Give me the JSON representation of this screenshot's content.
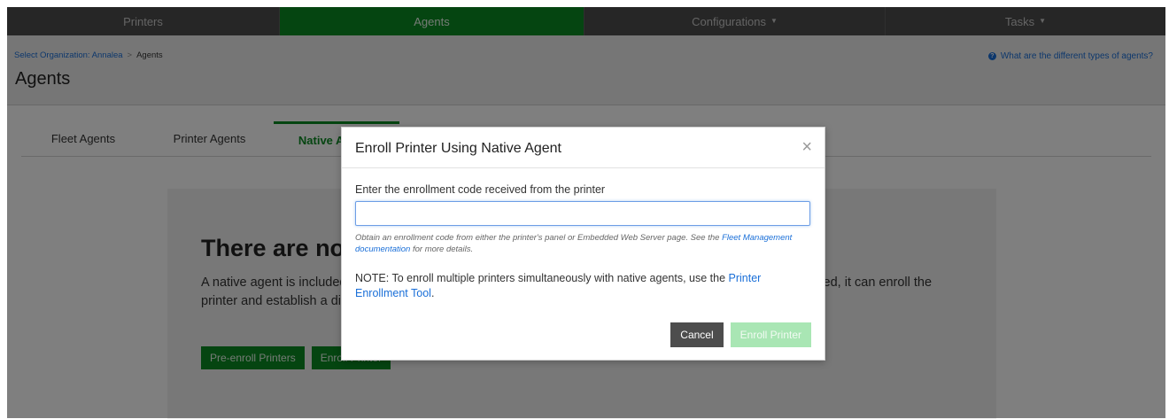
{
  "nav": {
    "items": [
      {
        "label": "Printers"
      },
      {
        "label": "Agents"
      },
      {
        "label": "Configurations",
        "dropdown": true
      },
      {
        "label": "Tasks",
        "dropdown": true
      }
    ],
    "active": "Agents"
  },
  "breadcrumb": {
    "org_link": "Select Organization: Annalea",
    "separator": ">",
    "current": "Agents"
  },
  "page": {
    "title": "Agents",
    "help_link": "What are the different types of agents?"
  },
  "tabs": [
    {
      "label": "Fleet Agents"
    },
    {
      "label": "Printer Agents"
    },
    {
      "label": "Native Agents"
    }
  ],
  "empty_state": {
    "title": "There are no native agents",
    "description": "A native agent is included in printer firmware for printers that are Internet of Things (IoT) capable. When enabled, it can enroll the printer and establish a direct connection between the printer and the cloud.",
    "preenroll_button": "Pre-enroll Printers",
    "enroll_button": "Enroll Printer"
  },
  "modal": {
    "title": "Enroll Printer Using Native Agent",
    "close_glyph": "×",
    "field_label": "Enter the enrollment code received from the printer",
    "input_value": "",
    "input_placeholder": "",
    "hint_prefix": "Obtain an enrollment code from either the printer's panel or Embedded Web Server page. See the ",
    "hint_link": "Fleet Management documentation",
    "hint_suffix": " for more details.",
    "note_prefix": "NOTE: To enroll multiple printers simultaneously with native agents, use the ",
    "note_link": "Printer Enrollment Tool",
    "note_suffix": ".",
    "cancel_label": "Cancel",
    "enroll_label": "Enroll Printer"
  },
  "colors": {
    "accent_green": "#0b8a22",
    "disabled_green": "#a9e6b4",
    "nav_bg": "#4d4d4d",
    "link_blue": "#1a6fd8"
  }
}
